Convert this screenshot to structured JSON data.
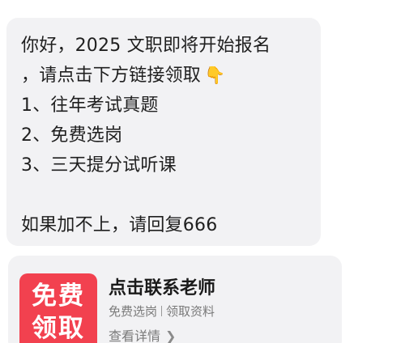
{
  "message": {
    "lines": [
      "你好，2025 文职即将开始报名",
      "，请点击下方链接领取",
      "1、往年考试真题",
      "2、免费选岗",
      "3、三天提分试听课",
      "如果加不上，请回复666"
    ],
    "emoji": "👇"
  },
  "card": {
    "badge_line1": "免费",
    "badge_line2": "领取",
    "title": "点击联系老师",
    "sub_left": "免费选岗",
    "sub_right": "领取资料",
    "link_text": "查看详情",
    "link_chevron": "❯"
  },
  "colors": {
    "bubble_bg": "#f2f2f4",
    "badge_red": "#f2414f",
    "secondary_text": "#7a7a7a"
  }
}
